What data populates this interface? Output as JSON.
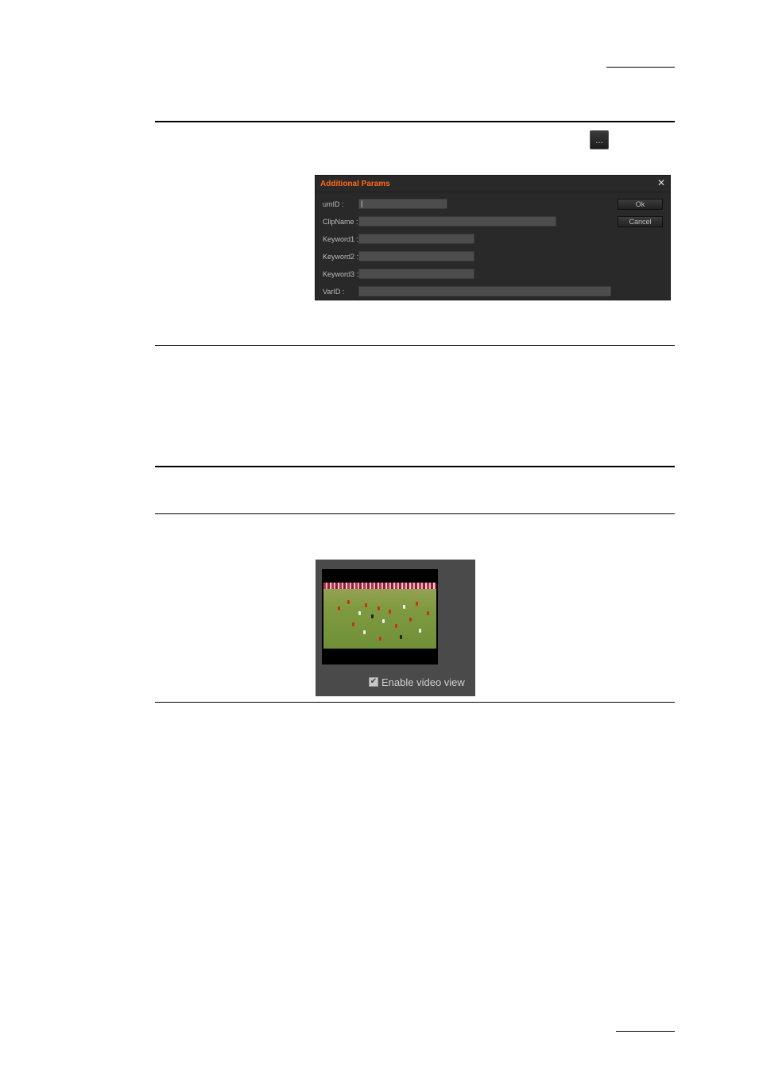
{
  "toolbar": {
    "ellipsis_label": "..."
  },
  "dialog": {
    "title": "Additional Params",
    "close_glyph": "✕",
    "fields": [
      {
        "label": "umID :",
        "value": "|"
      },
      {
        "label": "ClipName :",
        "value": ""
      },
      {
        "label": "Keyword1 :",
        "value": ""
      },
      {
        "label": "Keyword2 :",
        "value": ""
      },
      {
        "label": "Keyword3 :",
        "value": ""
      },
      {
        "label": "VarID :",
        "value": ""
      }
    ],
    "ok_label": "Ok",
    "cancel_label": "Cancel"
  },
  "video_panel": {
    "checkbox_checked": true,
    "checkbox_glyph": "✔",
    "checkbox_label": "Enable video view"
  },
  "colors": {
    "accent": "#ff6a10",
    "dialog_bg": "#292929",
    "panel_bg": "#4a4a4a"
  }
}
